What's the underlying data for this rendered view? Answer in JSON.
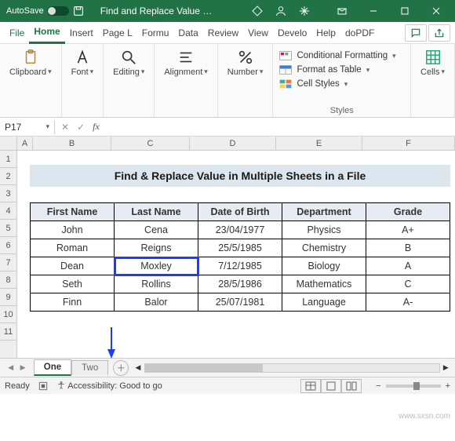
{
  "titlebar": {
    "autosave": "AutoSave",
    "doc": "Find and Replace Value …"
  },
  "menu": {
    "file": "File",
    "home": "Home",
    "insert": "Insert",
    "pagel": "Page L",
    "formu": "Formu",
    "data": "Data",
    "review": "Review",
    "view": "View",
    "develo": "Develo",
    "help": "Help",
    "dopdf": "doPDF"
  },
  "ribbon": {
    "clipboard": "Clipboard",
    "font": "Font",
    "editing": "Editing",
    "alignment": "Alignment",
    "number": "Number",
    "cond": "Conditional Formatting",
    "table": "Format as Table",
    "cellstyles": "Cell Styles",
    "styles": "Styles",
    "cells": "Cells"
  },
  "namebox": "P17",
  "cols": [
    "A",
    "B",
    "C",
    "D",
    "E",
    "F"
  ],
  "rows": [
    "1",
    "2",
    "3",
    "4",
    "5",
    "6",
    "7",
    "8",
    "9",
    "10",
    "11"
  ],
  "banner": "Find & Replace Value in Multiple Sheets in a File",
  "headers": [
    "First Name",
    "Last Name",
    "Date of Birth",
    "Department",
    "Grade"
  ],
  "data": [
    [
      "John",
      "Cena",
      "23/04/1977",
      "Physics",
      "A+"
    ],
    [
      "Roman",
      "Reigns",
      "25/5/1985",
      "Chemistry",
      "B"
    ],
    [
      "Dean",
      "Moxley",
      "7/12/1985",
      "Biology",
      "A"
    ],
    [
      "Seth",
      "Rollins",
      "28/5/1986",
      "Mathematics",
      "C"
    ],
    [
      "Finn",
      "Balor",
      "25/07/1981",
      "Language",
      "A-"
    ]
  ],
  "tabs": {
    "one": "One",
    "two": "Two"
  },
  "status": {
    "ready": "Ready",
    "access": "Accessibility: Good to go",
    "zoom": ""
  },
  "watermark": "www.sxsn.com",
  "chart_data": {
    "type": "table",
    "title": "Find & Replace Value in Multiple Sheets in a File",
    "columns": [
      "First Name",
      "Last Name",
      "Date of Birth",
      "Department",
      "Grade"
    ],
    "rows": [
      [
        "John",
        "Cena",
        "23/04/1977",
        "Physics",
        "A+"
      ],
      [
        "Roman",
        "Reigns",
        "25/5/1985",
        "Chemistry",
        "B"
      ],
      [
        "Dean",
        "Moxley",
        "7/12/1985",
        "Biology",
        "A"
      ],
      [
        "Seth",
        "Rollins",
        "28/5/1986",
        "Mathematics",
        "C"
      ],
      [
        "Finn",
        "Balor",
        "25/07/1981",
        "Language",
        "A-"
      ]
    ]
  }
}
